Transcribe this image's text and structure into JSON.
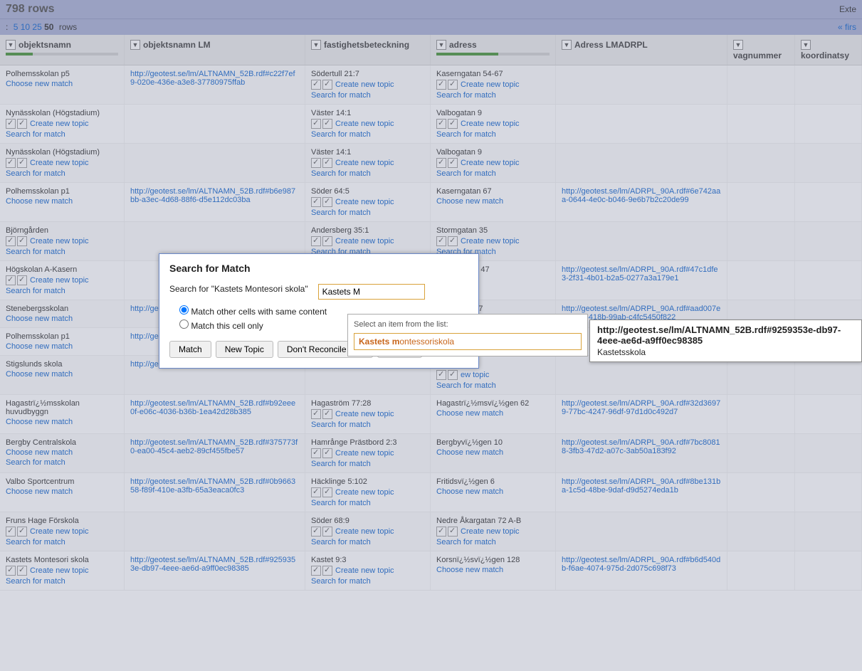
{
  "header": {
    "rows_title": "798 rows",
    "ext": "Exte"
  },
  "pager": {
    "colon": ":",
    "s5": "5",
    "s10": "10",
    "s25": "25",
    "s50": "50",
    "rows": "rows",
    "first": "« firs"
  },
  "columns": [
    {
      "label": "objektsnamn",
      "progress": 24
    },
    {
      "label": "objektsnamn LM",
      "progress": null
    },
    {
      "label": "fastighetsbeteckning",
      "progress": null
    },
    {
      "label": "adress",
      "progress": 55
    },
    {
      "label": "Adress LMADRPL",
      "progress": null
    },
    {
      "label": "vagnummer",
      "progress": null
    },
    {
      "label": "koordinatsy",
      "progress": null
    }
  ],
  "rows": [
    {
      "c0": {
        "t": "val",
        "v": "Polhemsskolan p5",
        "sub": "cnm"
      },
      "c1": {
        "t": "link",
        "v": "http://geotest.se/lm/ALTNAMN_52B.rdf#c22f7ef9-020e-436e-a3e8-37780975ffab"
      },
      "c2": {
        "t": "val",
        "v": "Södertull 21:7",
        "cnt": true,
        "sfm": true
      },
      "c3": {
        "t": "val",
        "v": "Kaserngatan 54-67",
        "cnt": true,
        "sfm": true
      },
      "c4": null,
      "c5": null,
      "c6": null
    },
    {
      "c0": {
        "t": "val",
        "v": "Nynässkolan (Högstadium)",
        "cnt": true,
        "sfm": true
      },
      "c1": null,
      "c2": {
        "t": "val",
        "v": "Väster 14:1",
        "cnt": true,
        "sfm": true
      },
      "c3": {
        "t": "val",
        "v": "Valbogatan 9",
        "cnt": true,
        "sfm": true
      },
      "c4": null,
      "c5": null,
      "c6": null
    },
    {
      "c0": {
        "t": "val",
        "v": "Nynässkolan (Högstadium)",
        "cnt": true,
        "sfm": true
      },
      "c1": null,
      "c2": {
        "t": "val",
        "v": "Väster 14:1",
        "cnt": true,
        "sfm": true
      },
      "c3": {
        "t": "val",
        "v": "Valbogatan 9",
        "cnt": true,
        "sfm": true
      },
      "c4": null,
      "c5": null,
      "c6": null
    },
    {
      "c0": {
        "t": "val",
        "v": "Polhemsskolan p1",
        "sub": "cnm"
      },
      "c1": {
        "t": "link",
        "v": "http://geotest.se/lm/ALTNAMN_52B.rdf#b6e987bb-a3ec-4d68-88f6-d5e112dc03ba"
      },
      "c2": {
        "t": "val",
        "v": "Söder 64:5",
        "cnt": true,
        "sfm": true
      },
      "c3": {
        "t": "val",
        "v": "Kaserngatan 67",
        "sub": "cnm"
      },
      "c4": {
        "t": "link",
        "v": "http://geotest.se/lm/ADRPL_90A.rdf#6e742aaa-0644-4e0c-b046-9e6b7b2c20de99"
      },
      "c5": null,
      "c6": null
    },
    {
      "c0": {
        "t": "val",
        "v": "Björngården",
        "cnt": true,
        "sfm": true
      },
      "c1": null,
      "c2": {
        "t": "val",
        "v": "Andersberg 35:1",
        "cnt": true,
        "sfm": true
      },
      "c3": {
        "t": "val",
        "v": "Stormgatan 35",
        "cnt": true,
        "sfm": true
      },
      "c4": null,
      "c5": null,
      "c6": null
    },
    {
      "c0": {
        "t": "val",
        "v": "Högskolan A-Kasern",
        "cnt": true,
        "sfm": true
      },
      "c1": null,
      "c2": null,
      "c3": {
        "t": "val",
        "v": "cksvï¿½gen 47",
        "sub2": "match"
      },
      "c4": {
        "t": "link",
        "v": "http://geotest.se/lm/ADRPL_90A.rdf#47c1dfe3-2f31-4b01-b2a5-0277a3a179e1"
      },
      "c5": null,
      "c6": null
    },
    {
      "c0": {
        "t": "val",
        "v": "Stenebergsskolan",
        "sub": "cnm"
      },
      "c1": {
        "t": "link",
        "v": "http://ge\nf572-48"
      },
      "c2": null,
      "c3": {
        "t": "val",
        "v": "ï¿½rgatan 27",
        "sub2": "match"
      },
      "c4": {
        "t": "link",
        "v": "http://geotest.se/lm/ADRPL_90A.rdf#aad007e2-4733-418b-99ab-c4fc5450f822"
      },
      "c5": null,
      "c6": null
    },
    {
      "c0": {
        "t": "val",
        "v": "Polhemsskolan p1",
        "sub": "cnm"
      },
      "c1": {
        "t": "link",
        "v": "http://ge\na3ec-4"
      },
      "c2": null,
      "c3": null,
      "c4": null,
      "c5": null,
      "c6": null
    },
    {
      "c0": {
        "t": "val",
        "v": "Stigslunds skola",
        "sub": "cnm"
      },
      "c1": {
        "t": "link",
        "v": "http://ge\na186-4"
      },
      "c2": null,
      "c3": {
        "t": "val",
        "v": "n 11-13",
        "cnt": true,
        "sfm": true,
        "cntlbl": "ew topic"
      },
      "c4": null,
      "c5": null,
      "c6": null
    },
    {
      "c0": {
        "t": "val",
        "v": "Hagastrï¿½msskolan huvudbyggn",
        "sub": "cnm"
      },
      "c1": {
        "t": "link",
        "v": "http://geotest.se/lm/ALTNAMN_52B.rdf#b92eee0f-e06c-4036-b36b-1ea42d28b385"
      },
      "c2": {
        "t": "val",
        "v": "Hagaström 77:28",
        "cnt": true,
        "sfm": true
      },
      "c3": {
        "t": "val",
        "v": "Hagastrï¿½msvï¿½gen 62",
        "sub": "cnm"
      },
      "c4": {
        "t": "link",
        "v": "http://geotest.se/lm/ADRPL_90A.rdf#32d36979-77bc-4247-96df-97d1d0c492d7"
      },
      "c5": null,
      "c6": null
    },
    {
      "c0": {
        "t": "val",
        "v": "Bergby Centralskola",
        "sub": "cnm",
        "sfm": true
      },
      "c1": {
        "t": "link",
        "v": "http://geotest.se/lm/ALTNAMN_52B.rdf#375773f0-ea00-45c4-aeb2-89cf455fbe57"
      },
      "c2": {
        "t": "val",
        "v": "Hamrånge Prästbord 2:3",
        "cnt": true,
        "sfm": true
      },
      "c3": {
        "t": "val",
        "v": "Bergbyvï¿½gen 10",
        "sub": "cnm"
      },
      "c4": {
        "t": "link",
        "v": "http://geotest.se/lm/ADRPL_90A.rdf#7bc80818-3fb3-47d2-a07c-3ab50a183f92"
      },
      "c5": null,
      "c6": null
    },
    {
      "c0": {
        "t": "val",
        "v": "Valbo Sportcentrum",
        "sub": "cnm"
      },
      "c1": {
        "t": "link",
        "v": "http://geotest.se/lm/ALTNAMN_52B.rdf#0b966358-f89f-410e-a3fb-65a3eaca0fc3"
      },
      "c2": {
        "t": "val",
        "v": "Häcklinge 5:102",
        "cnt": true,
        "sfm": true
      },
      "c3": {
        "t": "val",
        "v": "Fritidsvï¿½gen 6",
        "sub": "cnm"
      },
      "c4": {
        "t": "link",
        "v": "http://geotest.se/lm/ADRPL_90A.rdf#8be131ba-1c5d-48be-9daf-d9d5274eda1b"
      },
      "c5": null,
      "c6": null
    },
    {
      "c0": {
        "t": "val",
        "v": "Fruns Hage Förskola",
        "cnt": true,
        "sfm": true
      },
      "c1": null,
      "c2": {
        "t": "val",
        "v": "Söder 68:9",
        "cnt": true,
        "sfm": true
      },
      "c3": {
        "t": "val",
        "v": "Nedre Åkargatan 72 A-B",
        "cnt": true,
        "sfm": true
      },
      "c4": null,
      "c5": null,
      "c6": null
    },
    {
      "c0": {
        "t": "val",
        "v": "Kastets Montesori skola",
        "cnt": true,
        "sfm": true
      },
      "c1": {
        "t": "link",
        "v": "http://geotest.se/lm/ALTNAMN_52B.rdf#9259353e-db97-4eee-ae6d-a9ff0ec98385"
      },
      "c2": {
        "t": "val",
        "v": "Kastet 9:3",
        "cnt": true,
        "sfm": true
      },
      "c3": {
        "t": "val",
        "v": "Korsnï¿½svï¿½gen 128",
        "sub": "cnm"
      },
      "c4": {
        "t": "link",
        "v": "http://geotest.se/lm/ADRPL_90A.rdf#b6d540db-f6ae-4074-975d-2d075c698f73"
      },
      "c5": null,
      "c6": null
    }
  ],
  "labels": {
    "create_new_topic": "Create new topic",
    "search_for_match": "Search for match",
    "choose_new_match": "Choose new match"
  },
  "dialog": {
    "title": "Search for Match",
    "search_label": "Search for \"Kastets Montesori skola\"",
    "input_value": "Kastets M",
    "radio1": "Match other cells with same content",
    "radio2": "Match this cell only",
    "btn_match": "Match",
    "btn_newtopic": "New Topic",
    "btn_dontreconcile": "Don't Reconcile Cell",
    "btn_cancel": "Cancel"
  },
  "flyout": {
    "hint": "Select an item from the list:",
    "item_bold": "Kastets m",
    "item_rest": "ontessoriskola"
  },
  "tooltip": {
    "title": "http://geotest.se/lm/ALTNAMN_52B.rdf#9259353e-db97-4eee-ae6d-a9ff0ec98385",
    "sub": "Kastetsskola"
  }
}
